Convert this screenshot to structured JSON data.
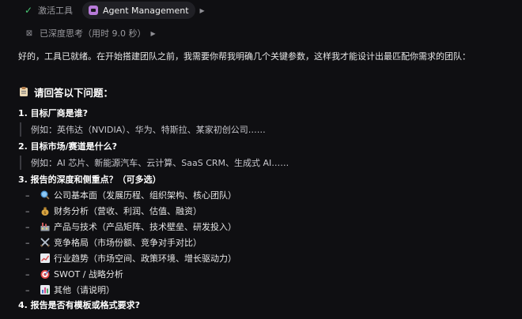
{
  "tool_row": {
    "activate_label": "激活工具",
    "chip_label": "Agent Management"
  },
  "thinking_label": "已深度思考（用时 9.0 秒）",
  "intro": "好的，工具已就绪。在开始搭建团队之前，我需要你帮我明确几个关键参数，这样我才能设计出最匹配你需求的团队：",
  "section_title": "请回答以下问题：",
  "questions": [
    {
      "title": "1. 目标厂商是谁?",
      "example": "例如：英伟达（NVIDIA）、华为、特斯拉、某家初创公司……"
    },
    {
      "title": "2. 目标市场/赛道是什么?",
      "example": "例如：AI 芯片、新能源汽车、云计算、SaaS CRM、生成式 AI……"
    },
    {
      "title": "3. 报告的深度和侧重点？（可多选）"
    },
    {
      "title": "4. 报告是否有模板或格式要求?"
    }
  ],
  "options": [
    {
      "icon": "magnifier-icon",
      "label": "公司基本面（发展历程、组织架构、核心团队）"
    },
    {
      "icon": "money-bag-icon",
      "label": "财务分析（营收、利润、估值、融资）"
    },
    {
      "icon": "factory-icon",
      "label": "产品与技术（产品矩阵、技术壁垒、研发投入）"
    },
    {
      "icon": "crossed-swords-icon",
      "label": "竞争格局（市场份额、竞争对手对比）"
    },
    {
      "icon": "trend-chart-icon",
      "label": "行业趋势（市场空间、政策环境、增长驱动力）"
    },
    {
      "icon": "target-icon",
      "label": "SWOT / 战略分析"
    },
    {
      "icon": "bar-chart-icon",
      "label": "其他（请说明）"
    }
  ],
  "colors": {
    "background": "#0f0f12",
    "check": "#48c774",
    "chip": "#202025"
  }
}
